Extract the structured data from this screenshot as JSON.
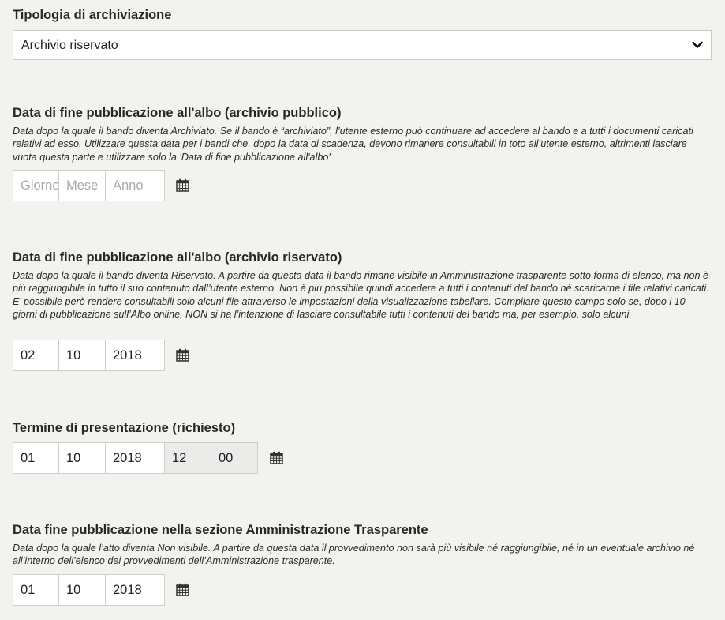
{
  "archiviazione": {
    "label": "Tipologia di archiviazione",
    "selected": "Archivio riservato"
  },
  "albo_pubblico": {
    "label": "Data di fine pubblicazione all'albo (archivio pubblico)",
    "description": "Data dopo la quale il bando diventa Archiviato. Se il bando è “archiviato”, l’utente esterno può continuare ad accedere al bando e a tutti i documenti caricati relativi ad esso. Utilizzare questa data per i bandi che, dopo la data di scadenza, devono rimanere consultabili in toto all’utente esterno, altrimenti lasciare vuota questa parte e utilizzare solo la 'Data di fine pubblicazione all'albo' .",
    "day": "",
    "month": "",
    "year": "",
    "day_placeholder": "Giorno",
    "month_placeholder": "Mese",
    "year_placeholder": "Anno"
  },
  "albo_riservato": {
    "label": "Data di fine pubblicazione all'albo (archivio riservato)",
    "description": "Data dopo la quale il bando diventa Riservato. A partire da questa data il bando rimane visibile in Amministrazione trasparente sotto forma di elenco, ma non è più raggiungibile in tutto il suo contenuto dall’utente esterno. Non è più possibile quindi accedere a tutti i contenuti del bando né scaricarne i file relativi caricati. E’ possibile però rendere consultabili solo alcuni file attraverso le impostazioni della visualizzazione tabellare. Compilare questo campo solo se, dopo i 10 giorni di pubblicazione sull’Albo online, NON si ha l’intenzione di lasciare consultabile tutti i contenuti del bando ma, per esempio, solo alcuni.",
    "day": "02",
    "month": "10",
    "year": "2018"
  },
  "termine": {
    "label": "Termine di presentazione (richiesto)",
    "day": "01",
    "month": "10",
    "year": "2018",
    "hour": "12",
    "minute": "00"
  },
  "trasparente": {
    "label": "Data fine pubblicazione nella sezione Amministrazione Trasparente",
    "description": "Data dopo la quale l’atto diventa Non visibile. A partire da questa data il provvedimento non sarà più visibile né raggiungibile, né in un eventuale archivio né all’interno dell’elenco dei provvedimenti dell’Amministrazione trasparente.",
    "day": "01",
    "month": "10",
    "year": "2018"
  },
  "icons": {
    "select": "chevron-down-icon",
    "date": "calendar-icon"
  }
}
